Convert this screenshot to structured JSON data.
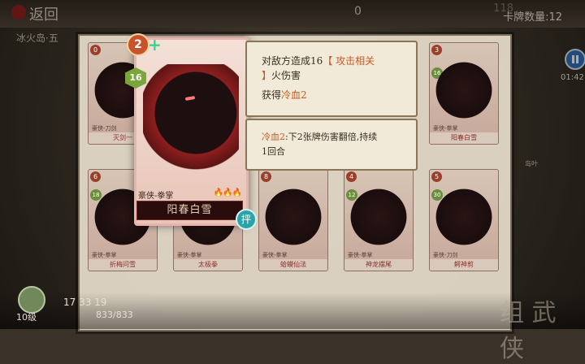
{
  "header": {
    "back_label": "返回",
    "top_value": "0",
    "deck_count_label": "卡牌数量:12",
    "deck_top_number": "118"
  },
  "subtitle": "冰火岛·五",
  "timer": "01:42",
  "featured_card": {
    "cost": "2",
    "gem_value": "16",
    "type": "豪侠-拳掌",
    "name": "阳春白雪",
    "seal": "抨",
    "flames": "🔥🔥🔥"
  },
  "description": {
    "line1_pre": "对敌方造成16",
    "line1_kw": "【 攻击相关",
    "line2_kw": "】",
    "line2_post": "火伤害",
    "line3_pre": "获得",
    "line3_kw": "冷血2",
    "detail_kw": "冷血2",
    "detail_rest": ":下2张牌伤害翻倍,持续",
    "detail_line2": "1回合"
  },
  "cards_row1": [
    {
      "cost": "0",
      "gem": "",
      "type": "豪侠-刀剑",
      "name": "灭剑一"
    },
    {
      "cost": "3",
      "gem": "16",
      "type": "豪侠-拳掌",
      "name": "阳春白雪"
    }
  ],
  "cards_row2": [
    {
      "cost": "6",
      "gem": "18",
      "type": "豪侠-拳掌",
      "name": "折梅问雪"
    },
    {
      "cost": "",
      "gem": "",
      "type": "豪侠-拳掌",
      "name": "太极拳"
    },
    {
      "cost": "8",
      "gem": "",
      "type": "豪侠-拳掌",
      "name": "蛤蟆仙法"
    },
    {
      "cost": "4",
      "gem": "12",
      "type": "豪侠-拳掌",
      "name": "神龙摆尾"
    },
    {
      "cost": "5",
      "gem": "30",
      "type": "豪侠-刀剑",
      "name": "鳄神剪"
    }
  ],
  "hud": {
    "stats": "17  33  19",
    "hp": "833/833",
    "level": "10级"
  },
  "side_label": "岛叶",
  "bottom_deco": "组 武 侠"
}
